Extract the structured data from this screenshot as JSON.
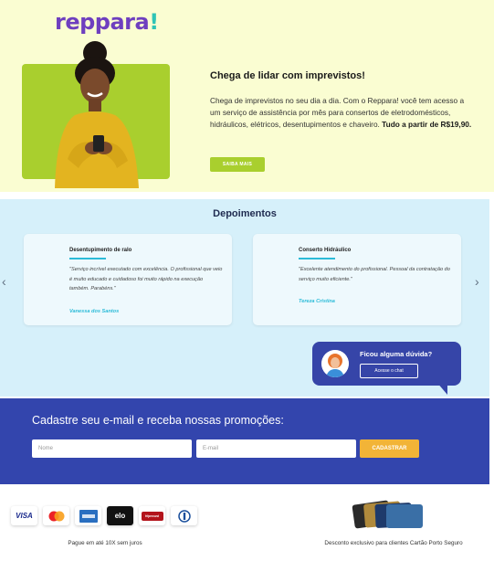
{
  "hero": {
    "logo": "reppara",
    "logo_mark": "!",
    "title": "Chega de lidar com imprevistos!",
    "text": "Chega de imprevistos no seu dia a dia. Com o Reppara! você tem acesso a um serviço de assistência por mês para consertos de eletrodomésticos, hidráulicos, elétricos, desentupimentos e chaveiro.",
    "price_text": "Tudo a partir de R$19,90.",
    "button": "SAIBA MAIS"
  },
  "testimonials": {
    "title": "Depoimentos",
    "prev_arrow": "‹",
    "next_arrow": "›",
    "items": [
      {
        "title": "Desentupimento de ralo",
        "quote": "\"Serviço incrível executado com excelência. O profissional que veio é muito educado e cuidadoso foi muito rápido na execução também. Parabéns.\"",
        "author": "Vanessa dos Santos"
      },
      {
        "title": "Conserto Hidráulico",
        "quote": "\"Excelente atendimento do profissional. Pessoal da contratação do serviço muito eficiente.\"",
        "author": "Tereza Cristina"
      }
    ]
  },
  "chat": {
    "question": "Ficou alguma dúvida?",
    "button": "Acesse o chat"
  },
  "newsletter": {
    "title": "Cadastre seu e-mail e receba nossas promoções:",
    "name_placeholder": "Nome",
    "email_placeholder": "E-mail",
    "button": "CADASTRAR"
  },
  "payments": {
    "brands": [
      "visa",
      "mastercard",
      "amex",
      "elo",
      "hipercard",
      "diners"
    ],
    "visa_label": "VISA",
    "elo_label": "elo",
    "hiper_label": "Hipercard",
    "installments_text": "Pague em até 10X sem juros",
    "discount_text": "Desconto exclusivo para clientes Cartão Porto Seguro"
  },
  "colors": {
    "hero_bg": "#fafdd2",
    "accent_green": "#a9cf2e",
    "brand_purple": "#6e3fbf",
    "testimonials_bg": "#d6f0fa",
    "accent_cyan": "#2bbbd8",
    "newsletter_bg": "#3345ad",
    "cta_yellow": "#f2b437"
  }
}
